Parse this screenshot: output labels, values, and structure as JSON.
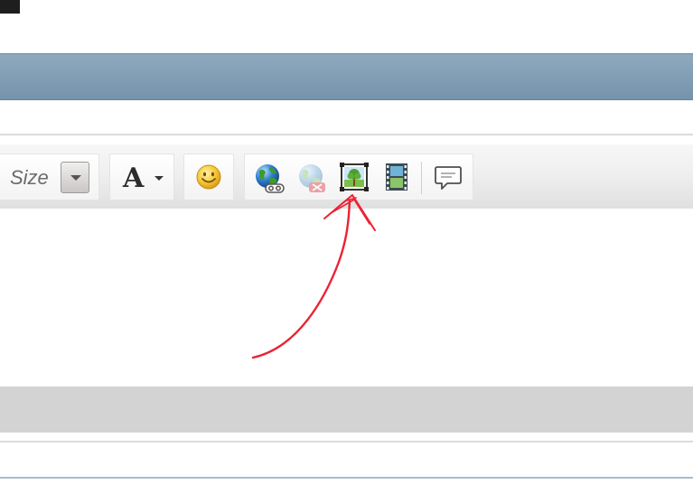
{
  "toolbar": {
    "size_label": "Size",
    "font_button_glyph": "A",
    "icons": [
      "size-dropdown-icon",
      "font-color-icon",
      "smiley-icon",
      "insert-link-icon",
      "remove-link-icon",
      "insert-image-icon",
      "insert-video-icon",
      "insert-comment-icon"
    ]
  },
  "colors": {
    "header_band": "#7f9ab2",
    "annotation_arrow": "#ec2233",
    "lower_band": "#d3d3d3"
  }
}
